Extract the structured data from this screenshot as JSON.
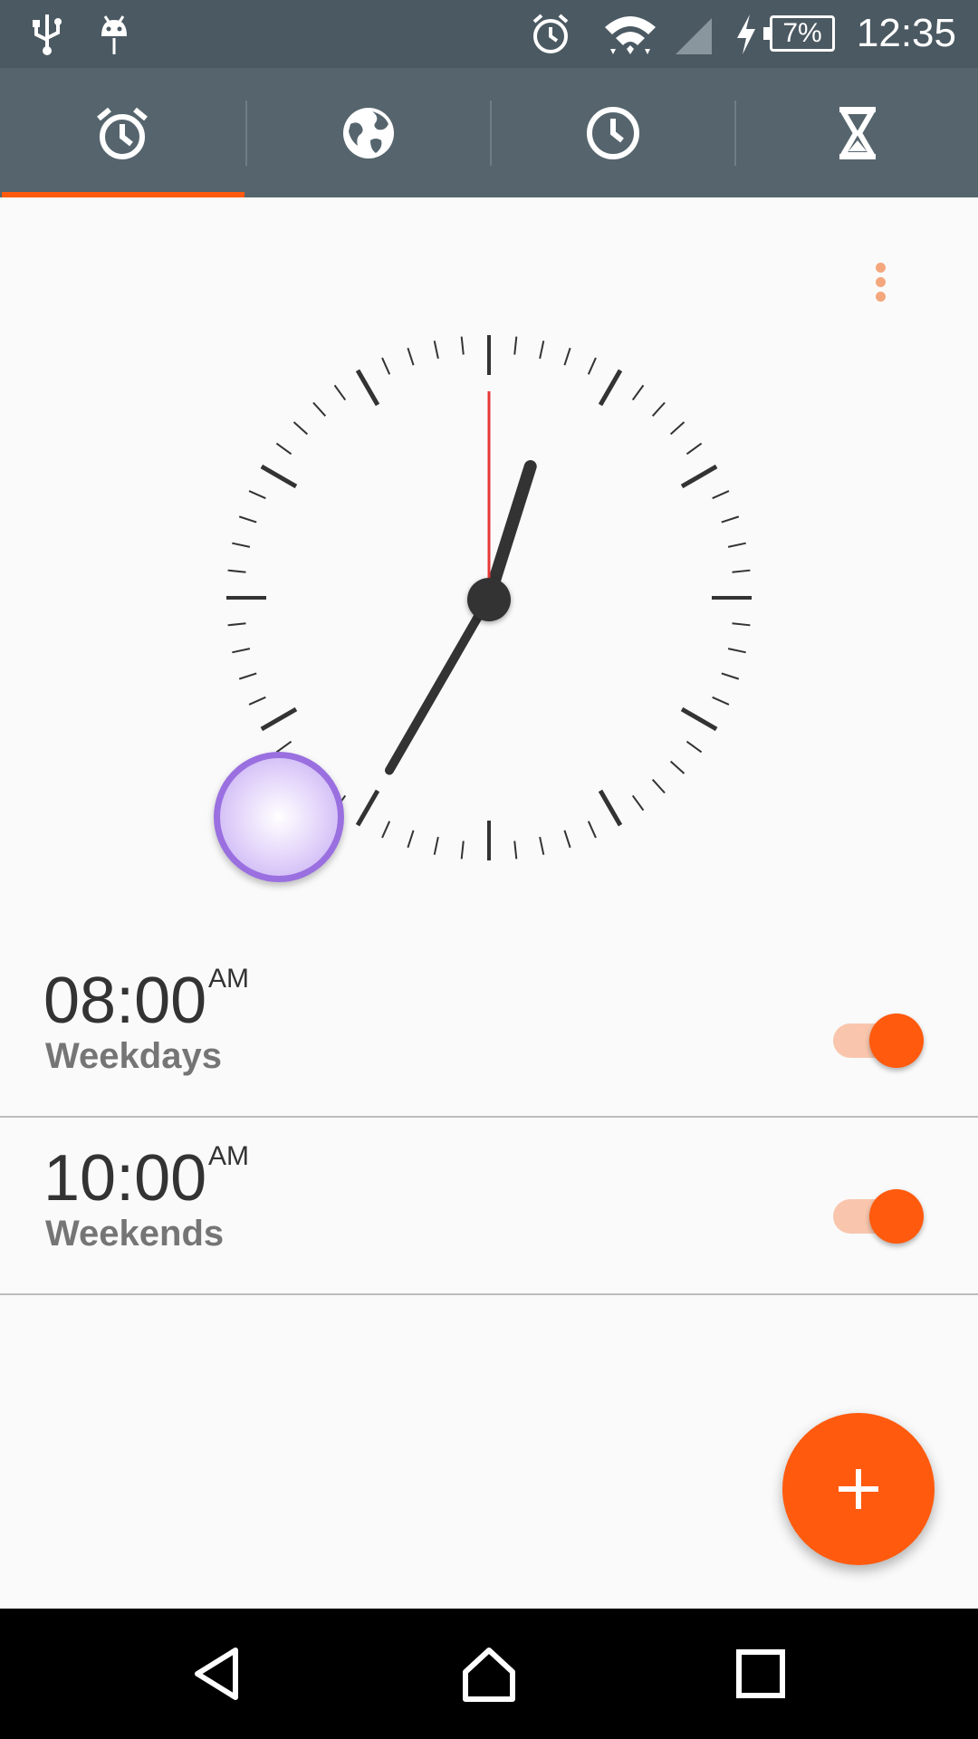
{
  "status_bar": {
    "time": "12:35",
    "battery_percent": "7%",
    "icons": [
      "usb-icon",
      "android-debug-icon",
      "alarm-icon",
      "wifi-icon",
      "cell-signal-icon",
      "charging-icon",
      "battery-icon"
    ]
  },
  "tabs": [
    {
      "name": "alarm",
      "icon": "alarm-clock-icon",
      "selected": true
    },
    {
      "name": "world-clock",
      "icon": "globe-icon",
      "selected": false
    },
    {
      "name": "clock",
      "icon": "clock-icon",
      "selected": false
    },
    {
      "name": "timer",
      "icon": "hourglass-icon",
      "selected": false
    }
  ],
  "clock": {
    "hour_hand_deg": 17.5,
    "minute_hand_deg": 210,
    "second_hand_deg": 0
  },
  "alarms": [
    {
      "time": "08:00",
      "ampm": "AM",
      "days": "Weekdays",
      "enabled": true
    },
    {
      "time": "10:00",
      "ampm": "AM",
      "days": "Weekends",
      "enabled": true
    }
  ],
  "colors": {
    "accent": "#ff5a0d",
    "status_bar": "#4b5962",
    "tab_bar": "#56656d",
    "second_hand": "#e53935"
  }
}
